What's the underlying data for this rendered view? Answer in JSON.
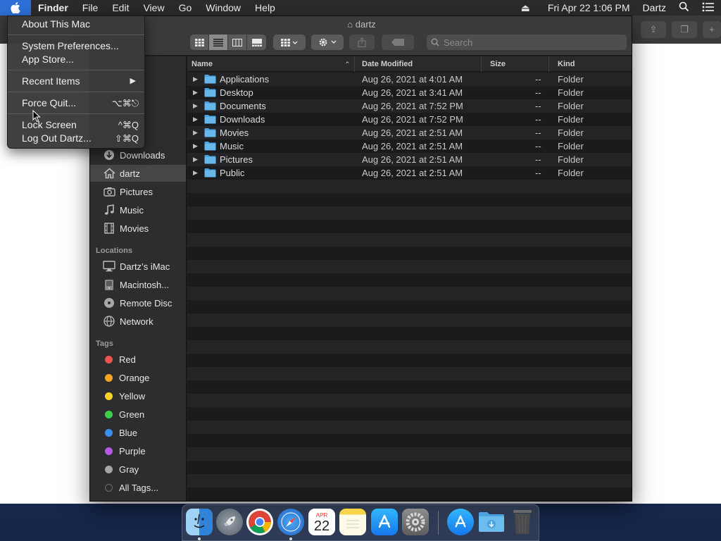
{
  "menubar": {
    "app_name": "Finder",
    "menus": [
      "File",
      "Edit",
      "View",
      "Go",
      "Window",
      "Help"
    ],
    "datetime": "Fri Apr 22  1:06 PM",
    "user": "Dartz"
  },
  "apple_menu": {
    "about": "About This Mac",
    "system_prefs": "System Preferences...",
    "app_store": "App Store...",
    "recent_items": "Recent Items",
    "force_quit": "Force Quit...",
    "force_quit_shortcut": "⌥⌘⎋",
    "lock_screen": "Lock Screen",
    "lock_screen_shortcut": "^⌘Q",
    "log_out": "Log Out Dartz...",
    "log_out_shortcut": "⇧⌘Q"
  },
  "finder": {
    "title": "dartz",
    "search_placeholder": "Search",
    "sidebar": {
      "favorites": [
        {
          "label": "Downloads",
          "icon": "download-icon"
        },
        {
          "label": "dartz",
          "icon": "home-icon",
          "selected": true
        },
        {
          "label": "Pictures",
          "icon": "camera-icon"
        },
        {
          "label": "Music",
          "icon": "music-note-icon"
        },
        {
          "label": "Movies",
          "icon": "film-icon"
        }
      ],
      "locations_header": "Locations",
      "locations": [
        {
          "label": "Dartz’s iMac",
          "icon": "imac-icon"
        },
        {
          "label": "Macintosh...",
          "icon": "hard-drive-icon"
        },
        {
          "label": "Remote Disc",
          "icon": "disc-icon"
        },
        {
          "label": "Network",
          "icon": "globe-icon"
        }
      ],
      "tags_header": "Tags",
      "tags": [
        {
          "label": "Red",
          "color": "#ef5350"
        },
        {
          "label": "Orange",
          "color": "#f6a623"
        },
        {
          "label": "Yellow",
          "color": "#f5d327"
        },
        {
          "label": "Green",
          "color": "#3ecf4a"
        },
        {
          "label": "Blue",
          "color": "#3b8ff0"
        },
        {
          "label": "Purple",
          "color": "#b65ae0"
        },
        {
          "label": "Gray",
          "color": "#a6a6a6"
        },
        {
          "label": "All Tags...",
          "color": "#6a6a6a"
        }
      ]
    },
    "columns": {
      "name": "Name",
      "date": "Date Modified",
      "size": "Size",
      "kind": "Kind"
    },
    "rows": [
      {
        "name": "Applications",
        "date": "Aug 26, 2021 at 4:01 AM",
        "size": "--",
        "kind": "Folder"
      },
      {
        "name": "Desktop",
        "date": "Aug 26, 2021 at 3:41 AM",
        "size": "--",
        "kind": "Folder"
      },
      {
        "name": "Documents",
        "date": "Aug 26, 2021 at 7:52 PM",
        "size": "--",
        "kind": "Folder"
      },
      {
        "name": "Downloads",
        "date": "Aug 26, 2021 at 7:52 PM",
        "size": "--",
        "kind": "Folder"
      },
      {
        "name": "Movies",
        "date": "Aug 26, 2021 at 2:51 AM",
        "size": "--",
        "kind": "Folder"
      },
      {
        "name": "Music",
        "date": "Aug 26, 2021 at 2:51 AM",
        "size": "--",
        "kind": "Folder"
      },
      {
        "name": "Pictures",
        "date": "Aug 26, 2021 at 2:51 AM",
        "size": "--",
        "kind": "Folder"
      },
      {
        "name": "Public",
        "date": "Aug 26, 2021 at 2:51 AM",
        "size": "--",
        "kind": "Folder"
      }
    ]
  },
  "dock": {
    "calendar_month": "APR",
    "calendar_day": "22"
  }
}
